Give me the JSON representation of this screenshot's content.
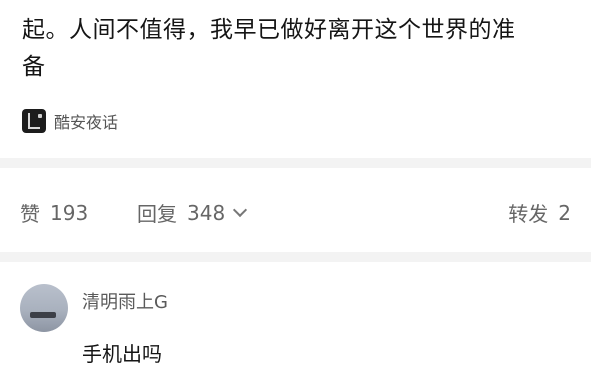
{
  "post": {
    "text_line1": "起。人间不值得，我早已做好离开这个世界的准",
    "text_line2": "备",
    "source": {
      "icon": "app-logo-icon",
      "name": "酷安夜话"
    }
  },
  "actions": {
    "like": {
      "label": "赞",
      "count": "193"
    },
    "comment": {
      "label": "回复",
      "count": "348",
      "icon": "chevron-down-icon"
    },
    "repost": {
      "label": "转发",
      "count": "2"
    }
  },
  "comment": {
    "username": "清明雨上G",
    "text": "手机出吗"
  },
  "colors": {
    "background": "#ffffff",
    "separator": "#f3f3f3",
    "secondary_text": "#666666",
    "primary_text": "#151515"
  }
}
